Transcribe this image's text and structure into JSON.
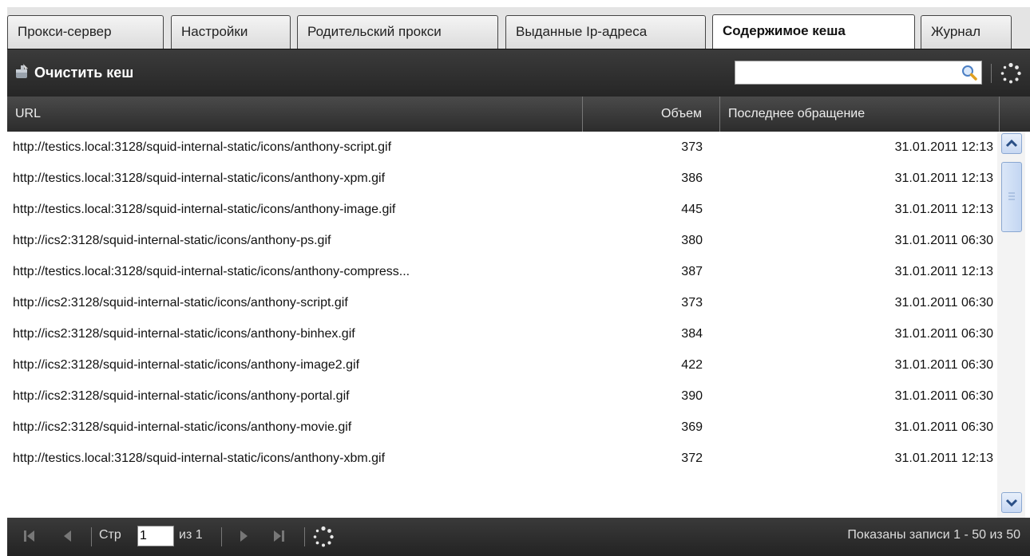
{
  "tabs": [
    {
      "label": "Прокси-сервер"
    },
    {
      "label": "Настройки"
    },
    {
      "label": "Родительский прокси"
    },
    {
      "label": "Выданные Ip-адреса"
    },
    {
      "label": "Содержимое кеша"
    },
    {
      "label": "Журнал"
    }
  ],
  "active_tab": "Содержимое кеша",
  "toolbar": {
    "clear_cache_label": "Очистить кеш",
    "search_value": "",
    "search_placeholder": ""
  },
  "grid": {
    "columns": {
      "url": "URL",
      "size": "Объем",
      "last_access": "Последнее обращение"
    },
    "rows": [
      {
        "url": "http://testics.local:3128/squid-internal-static/icons/anthony-script.gif",
        "size": "373",
        "last_access": "31.01.2011 12:13"
      },
      {
        "url": "http://testics.local:3128/squid-internal-static/icons/anthony-xpm.gif",
        "size": "386",
        "last_access": "31.01.2011 12:13"
      },
      {
        "url": "http://testics.local:3128/squid-internal-static/icons/anthony-image.gif",
        "size": "445",
        "last_access": "31.01.2011 12:13"
      },
      {
        "url": "http://ics2:3128/squid-internal-static/icons/anthony-ps.gif",
        "size": "380",
        "last_access": "31.01.2011 06:30"
      },
      {
        "url": "http://testics.local:3128/squid-internal-static/icons/anthony-compress...",
        "size": "387",
        "last_access": "31.01.2011 12:13"
      },
      {
        "url": "http://ics2:3128/squid-internal-static/icons/anthony-script.gif",
        "size": "373",
        "last_access": "31.01.2011 06:30"
      },
      {
        "url": "http://ics2:3128/squid-internal-static/icons/anthony-binhex.gif",
        "size": "384",
        "last_access": "31.01.2011 06:30"
      },
      {
        "url": "http://ics2:3128/squid-internal-static/icons/anthony-image2.gif",
        "size": "422",
        "last_access": "31.01.2011 06:30"
      },
      {
        "url": "http://ics2:3128/squid-internal-static/icons/anthony-portal.gif",
        "size": "390",
        "last_access": "31.01.2011 06:30"
      },
      {
        "url": "http://ics2:3128/squid-internal-static/icons/anthony-movie.gif",
        "size": "369",
        "last_access": "31.01.2011 06:30"
      },
      {
        "url": "http://testics.local:3128/squid-internal-static/icons/anthony-xbm.gif",
        "size": "372",
        "last_access": "31.01.2011 12:13"
      }
    ]
  },
  "pager": {
    "page_label": "Стр",
    "page_value": "1",
    "of_label": "из 1",
    "status": "Показаны записи 1 - 50 из 50"
  },
  "icons": {
    "clear_cache": "broom-icon",
    "search": "search-icon",
    "refresh": "refresh-icon",
    "first": "first-page-icon",
    "prev": "prev-page-icon",
    "next": "next-page-icon",
    "last": "last-page-icon"
  }
}
